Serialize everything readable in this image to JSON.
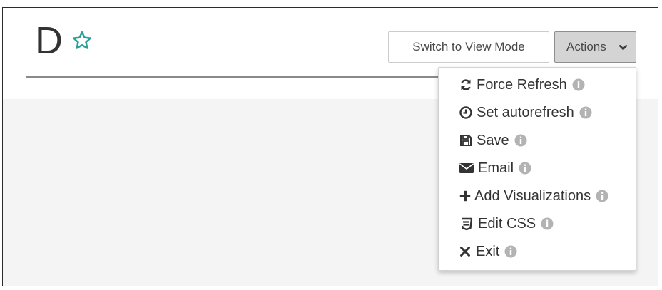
{
  "dashboard": {
    "title": "D"
  },
  "toolbar": {
    "view_mode_label": "Switch to View Mode",
    "actions_label": "Actions"
  },
  "actions_menu": {
    "items": [
      {
        "label": "Force Refresh",
        "icon": "refresh-icon"
      },
      {
        "label": "Set autorefresh",
        "icon": "clock-icon"
      },
      {
        "label": "Save",
        "icon": "save-icon"
      },
      {
        "label": "Email",
        "icon": "envelope-icon"
      },
      {
        "label": "Add Visualizations",
        "icon": "plus-icon"
      },
      {
        "label": "Edit CSS",
        "icon": "css-icon"
      },
      {
        "label": "Exit",
        "icon": "close-icon"
      }
    ]
  },
  "colors": {
    "star": "#2aa198",
    "info_icon": "#b3b3b3",
    "actions_bg": "#d4d4d4",
    "content_bg": "#f4f4f4"
  }
}
